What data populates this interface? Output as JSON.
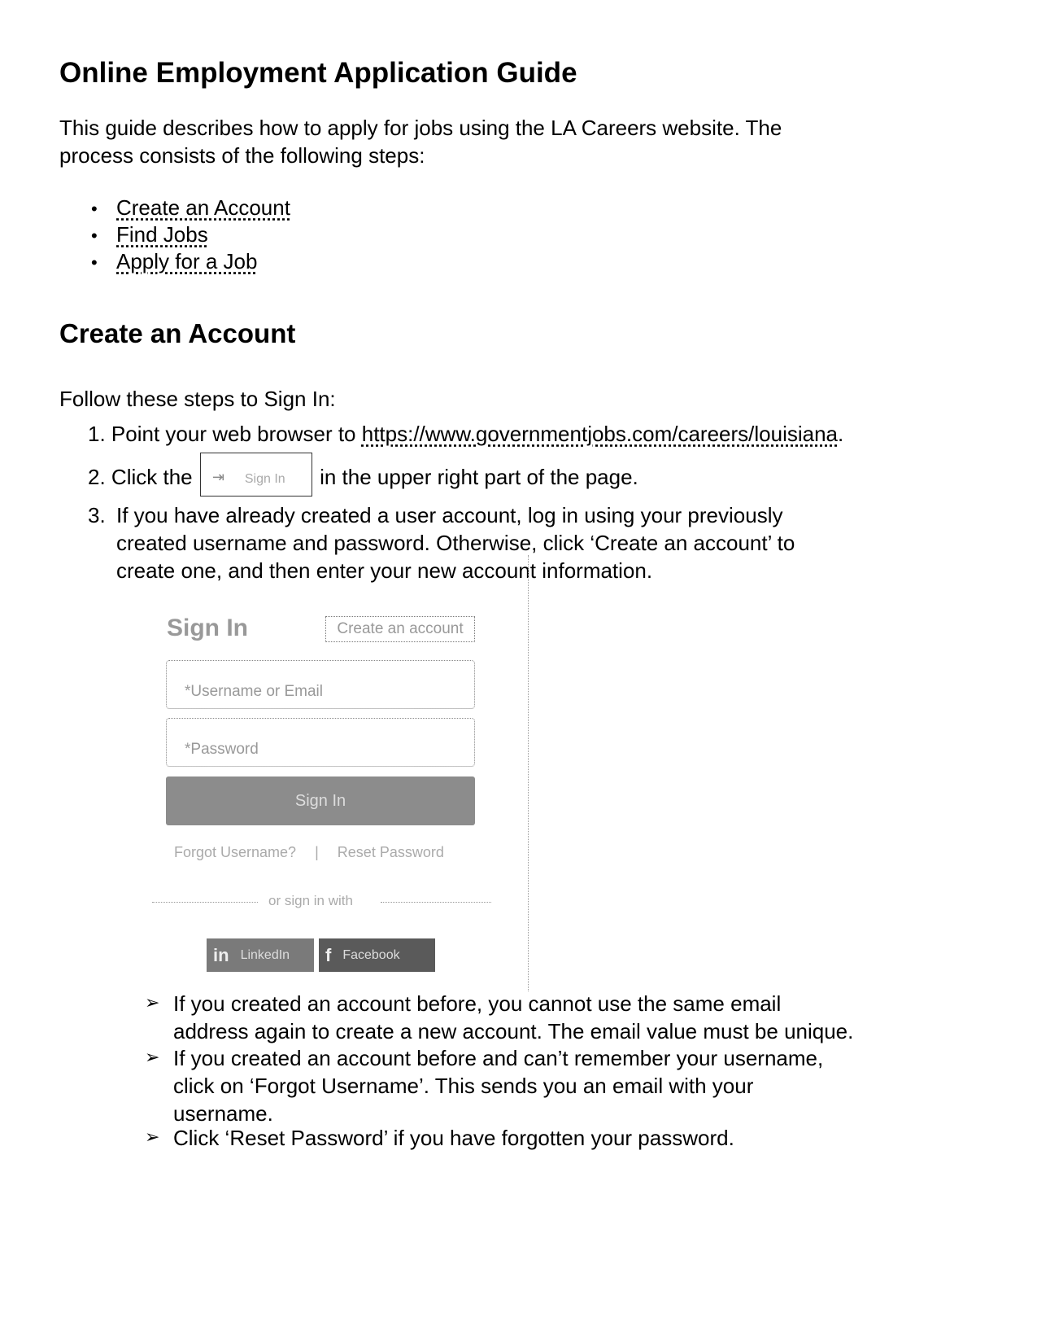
{
  "title": "Online Employment Application Guide",
  "intro": {
    "line1": "This guide describes how to apply for jobs using the LA Careers website. The",
    "line2": "process consists of the following steps:"
  },
  "toc": [
    {
      "label": "Create an Account"
    },
    {
      "label": "Find Jobs"
    },
    {
      "label": "Apply for a Job"
    }
  ],
  "section": {
    "heading": "Create an Account",
    "lead": "Follow these steps to Sign In:",
    "steps": [
      {
        "num": "1.",
        "before": "Point your web browser to ",
        "link": "https://www.governmentjobs.com/careers/louisiana",
        "after": "."
      },
      {
        "num": "2.",
        "before": "Click the ",
        "after": " in the upper right part of the page.",
        "inline_button": {
          "icon": "sign-in-icon",
          "glyph": "⇥",
          "label": "Sign In"
        }
      },
      {
        "num": "3.",
        "lines": [
          "If you have already created a user account, log in using your previously",
          "created username and password.  Otherwise, click ‘Create an account’ to",
          "create one, and then enter your new account information."
        ]
      }
    ]
  },
  "signin_panel": {
    "title": "Sign In",
    "create_account": "Create an account",
    "username_placeholder": "*Username or Email",
    "password_placeholder": "*Password",
    "submit": "Sign In",
    "forgot_username": "Forgot Username?",
    "separator": "|",
    "reset_password": "Reset Password",
    "or_sign_in_with": "or sign in with",
    "linkedin": {
      "icon": "in",
      "label": "LinkedIn"
    },
    "facebook": {
      "icon": "f",
      "label": "Facebook"
    }
  },
  "notes": [
    {
      "lines": [
        "If you created an account before, you cannot use the same email",
        "address again to create a new account. The email value must be unique."
      ]
    },
    {
      "lines": [
        "If you created an account before and can’t remember your username,",
        "click on ‘Forgot Username’. This sends you an email with your",
        "username."
      ]
    },
    {
      "lines": [
        "Click ‘Reset Password’ if you have forgotten your password."
      ]
    }
  ],
  "glyphs": {
    "bullet": "•",
    "arrow": "➢"
  }
}
